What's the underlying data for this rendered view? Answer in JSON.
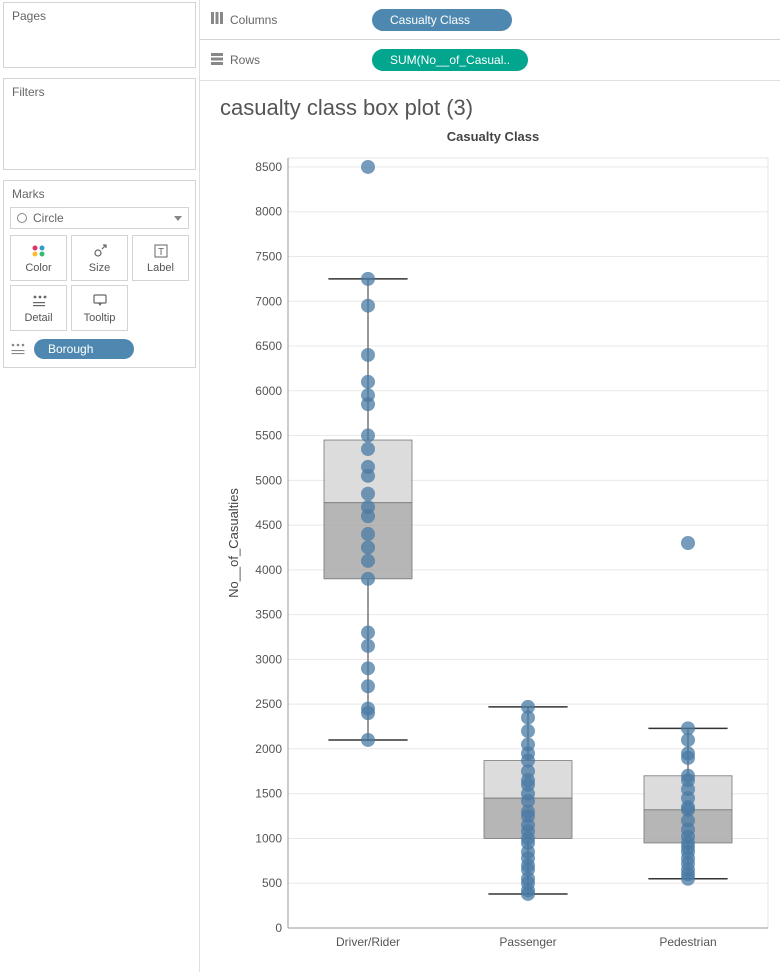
{
  "sidebar": {
    "pages_title": "Pages",
    "filters_title": "Filters",
    "marks_title": "Marks",
    "mark_type": "Circle",
    "buttons": {
      "color": "Color",
      "size": "Size",
      "label": "Label",
      "detail": "Detail",
      "tooltip": "Tooltip"
    },
    "detail_pill": "Borough"
  },
  "shelves": {
    "columns_label": "Columns",
    "rows_label": "Rows",
    "columns_pill": "Casualty Class",
    "rows_pill": "SUM(No__of_Casual.."
  },
  "viz": {
    "title": "casualty class box plot (3)",
    "column_header": "Casualty Class",
    "y_axis_label": "No__of_Casualties"
  },
  "chart_data": {
    "type": "boxplot_with_points",
    "x_axis": {
      "label": "Casualty Class",
      "categories": [
        "Driver/Rider",
        "Passenger",
        "Pedestrian"
      ]
    },
    "y_axis": {
      "label": "No__of_Casualties",
      "ticks": [
        0,
        500,
        1000,
        1500,
        2000,
        2500,
        3000,
        3500,
        4000,
        4500,
        5000,
        5500,
        6000,
        6500,
        7000,
        7500,
        8000,
        8500
      ],
      "range": [
        0,
        8600
      ]
    },
    "series": [
      {
        "name": "Driver/Rider",
        "box": {
          "whisker_low": 2100,
          "q1": 3900,
          "median": 4750,
          "q3": 5450,
          "whisker_high": 7250
        },
        "points": [
          8500,
          7250,
          6950,
          6400,
          6100,
          5950,
          5850,
          5500,
          5350,
          5150,
          5050,
          4850,
          4700,
          4600,
          4400,
          4250,
          4100,
          3900,
          3300,
          3150,
          2900,
          2700,
          2450,
          2400,
          2100
        ],
        "outliers": [
          8500
        ]
      },
      {
        "name": "Passenger",
        "box": {
          "whisker_low": 380,
          "q1": 1000,
          "median": 1450,
          "q3": 1870,
          "whisker_high": 2470
        },
        "points": [
          2470,
          2350,
          2200,
          2050,
          1950,
          1870,
          1750,
          1650,
          1600,
          1500,
          1420,
          1300,
          1250,
          1150,
          1080,
          1000,
          950,
          850,
          780,
          700,
          650,
          550,
          500,
          420,
          380
        ],
        "outliers": []
      },
      {
        "name": "Pedestrian",
        "box": {
          "whisker_low": 550,
          "q1": 950,
          "median": 1320,
          "q3": 1700,
          "whisker_high": 2230
        },
        "points": [
          4300,
          2230,
          2100,
          1950,
          1900,
          1700,
          1650,
          1550,
          1450,
          1350,
          1320,
          1200,
          1100,
          1020,
          950,
          900,
          850,
          780,
          720,
          650,
          600,
          550
        ],
        "outliers": [
          4300
        ]
      }
    ]
  }
}
